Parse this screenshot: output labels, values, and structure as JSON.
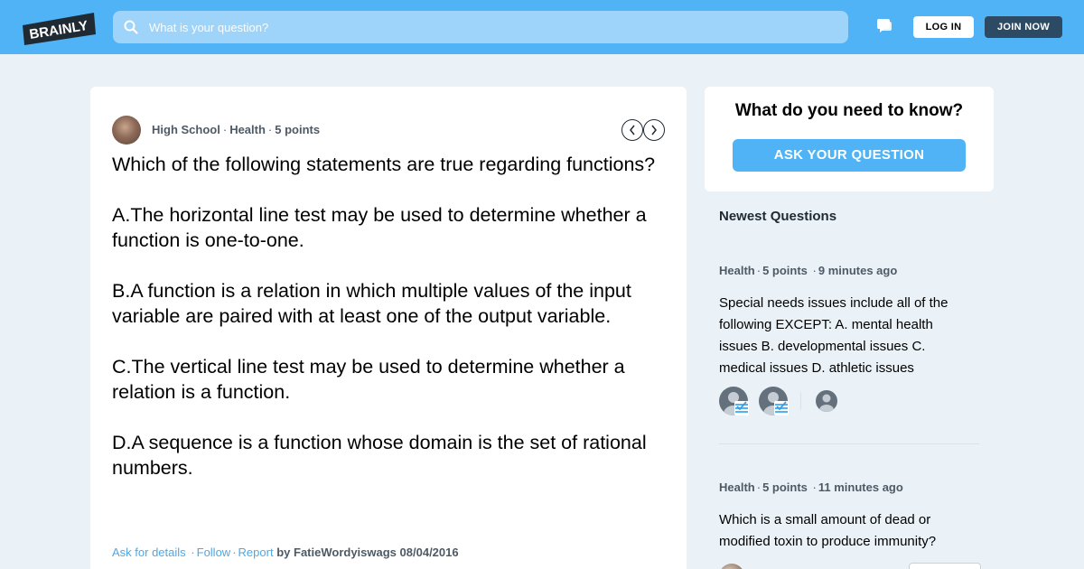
{
  "header": {
    "logo_text": "BRAINLY",
    "search_placeholder": "What is your question?",
    "login_label": "LOG IN",
    "join_label": "JOIN NOW",
    "accent_color": "#4fb3f6"
  },
  "question": {
    "level": "High School",
    "subject": "Health",
    "points": "5 points",
    "body": "Which of the following statements are true regarding functions?\n\nA.The horizontal line test may be used to determine whether a function is one-to-one.\n\nB.A function is a relation in which multiple values of the input variable are paired with at least one of the output variable.\n\nC.The vertical line test may be used to determine whether a relation is a function.\n\nD.A sequence is a function whose domain is the set of rational numbers.",
    "actions": {
      "ask_details": "Ask for details",
      "follow": "Follow",
      "report": "Report",
      "by_prefix": "by",
      "author": "FatieWordyiswags",
      "date": "08/04/2016"
    }
  },
  "ask_card": {
    "title": "What do you need to know?",
    "button_label": "ASK YOUR QUESTION"
  },
  "newest": {
    "title": "Newest Questions",
    "items": [
      {
        "subject": "Health",
        "points": "5 points",
        "time": "9 minutes ago",
        "text": "Special needs issues include all of the following EXCEPT: A. mental health issues B. developmental issues C. medical issues D. athletic issues"
      },
      {
        "subject": "Health",
        "points": "5 points",
        "time": "11 minutes ago",
        "text": "Which is a small amount of dead or modified toxin to produce immunity?"
      }
    ]
  }
}
